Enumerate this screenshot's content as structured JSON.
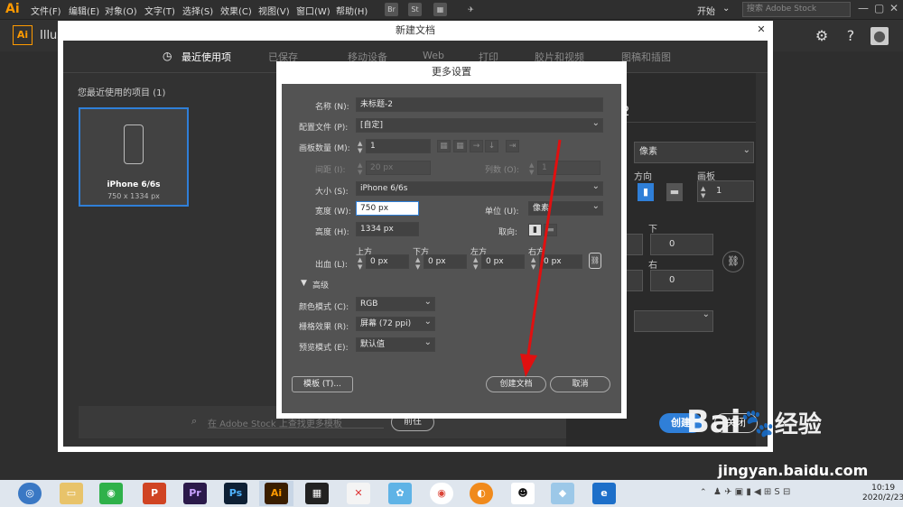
{
  "menubar": {
    "logo": "Ai",
    "items": [
      "文件(F)",
      "编辑(E)",
      "对象(O)",
      "文字(T)",
      "选择(S)",
      "效果(C)",
      "视图(V)",
      "窗口(W)",
      "帮助(H)"
    ],
    "bridge": "Br",
    "stock": "St",
    "workspace": "开始",
    "search_placeholder": "搜索 Adobe Stock"
  },
  "appbar": {
    "logo": "Ai",
    "name": "Illus"
  },
  "new_doc": {
    "title": "新建文档",
    "tabs": [
      "最近使用项",
      "已保存",
      "移动设备",
      "Web",
      "打印",
      "胶片和视频",
      "图稿和插图"
    ],
    "recent_label": "您最近使用的项目",
    "recent_count": "(1)",
    "card": {
      "name": "iPhone 6/6s",
      "size": "750 x 1334 px"
    },
    "stock_placeholder": "在 Adobe Stock 上查找更多模板",
    "stock_go": "前往",
    "right": {
      "num": "2",
      "unit": "像素",
      "orient_label": "方向",
      "boards_label": "画板",
      "boards": "1",
      "bottom_label": "下",
      "bottom": "0",
      "right_label": "右",
      "right": "0"
    },
    "create": "创建",
    "close": "关闭"
  },
  "more_settings": {
    "title": "更多设置",
    "name_label": "名称 (N):",
    "name": "未标题-2",
    "profile_label": "配置文件 (P):",
    "profile": "[自定]",
    "boards_label": "画板数量 (M):",
    "boards": "1",
    "spacing_label": "间距 (I):",
    "spacing": "20 px",
    "cols_label": "列数 (O):",
    "cols": "1",
    "size_label": "大小 (S):",
    "size": "iPhone 6/6s",
    "width_label": "宽度 (W):",
    "width": "750 px",
    "unit_label": "单位 (U):",
    "unit": "像素",
    "height_label": "高度 (H):",
    "height": "1334 px",
    "orient_label": "取向:",
    "bleed_label": "出血 (L):",
    "bleed_top_label": "上方",
    "bleed_bottom_label": "下方",
    "bleed_left_label": "左方",
    "bleed_right_label": "右方",
    "bleed_top": "0 px",
    "bleed_bottom": "0 px",
    "bleed_left": "0 px",
    "bleed_right": "0 px",
    "advanced": "高级",
    "color_label": "颜色模式 (C):",
    "color": "RGB",
    "raster_label": "栅格效果 (R):",
    "raster": "屏幕 (72 ppi)",
    "preview_label": "预览模式 (E):",
    "preview": "默认值",
    "template_btn": "模板 (T)...",
    "create_btn": "创建文档",
    "cancel_btn": "取消"
  },
  "taskbar": {
    "time": "10:19",
    "date": "2020/2/23",
    "apps": [
      "Pr",
      "Ps",
      "Ai"
    ]
  },
  "watermark": {
    "brand": "Bai",
    "sub": "经验",
    "url": "jingyan.baidu.com"
  },
  "colors": {
    "accent": "#2f7fd8",
    "ai_orange": "#ff9a00",
    "arrow": "#e01010"
  }
}
